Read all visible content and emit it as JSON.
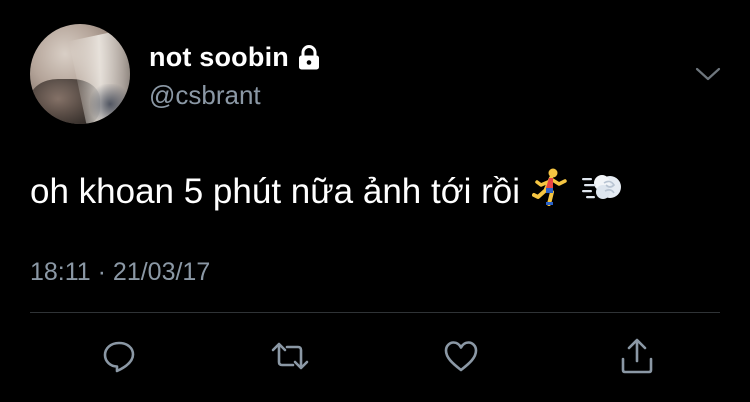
{
  "tweet": {
    "display_name": "not soobin",
    "handle": "@csbrant",
    "text": "oh khoan 5 phút nữa ảnh tới rồi",
    "emojis": [
      "runner-emoji",
      "dash-emoji"
    ],
    "timestamp": "18:11 · 21/03/17",
    "protected": true
  },
  "icons": {
    "lock": "lock-icon",
    "menu": "chevron-down-icon",
    "reply": "reply-icon",
    "retweet": "retweet-icon",
    "like": "heart-icon",
    "share": "share-icon"
  },
  "colors": {
    "background": "#000000",
    "primary_text": "#ffffff",
    "secondary_text": "#8b98a5",
    "divider": "#2f3336"
  }
}
